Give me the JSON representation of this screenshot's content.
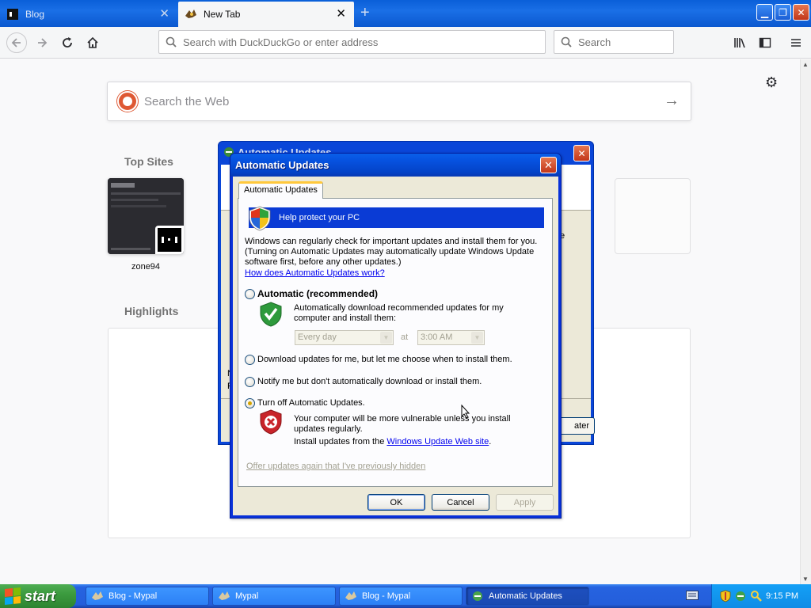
{
  "browser": {
    "tabs": [
      {
        "title": "Blog",
        "active": false
      },
      {
        "title": "New Tab",
        "active": true
      }
    ],
    "urlbar_placeholder": "Search with DuckDuckGo or enter address",
    "searchbar_placeholder": "Search"
  },
  "newtab": {
    "websearch_placeholder": "Search the Web",
    "top_sites_title": "Top Sites",
    "top_sites": [
      {
        "label": "zone94"
      }
    ],
    "highlights_title": "Highlights"
  },
  "background_window": {
    "title": "Automatic Updates",
    "fragment_1": "N",
    "fragment_2": "F",
    "fragment_3": "e",
    "button_fragment": "ater"
  },
  "dialog": {
    "title": "Automatic Updates",
    "tab_label": "Automatic Updates",
    "banner": "Help protect your PC",
    "intro_line1": "Windows can regularly check for important updates and install them for you.",
    "intro_line2": "(Turning on Automatic Updates may automatically update Windows Update",
    "intro_line3": "software first, before any other updates.)",
    "help_link": "How does Automatic Updates work?",
    "options": {
      "automatic_label": "Automatic (recommended)",
      "automatic_desc1": "Automatically download recommended updates for my",
      "automatic_desc2": "computer and install them:",
      "day_value": "Every day",
      "at_label": "at",
      "time_value": "3:00 AM",
      "download_label": "Download updates for me, but let me choose when to install them.",
      "notify_label": "Notify me but don't automatically download or install them.",
      "off_label": "Turn off Automatic Updates.",
      "off_desc1": "Your computer will be more vulnerable unless you install",
      "off_desc2": "updates regularly.",
      "off_desc3_prefix": "Install updates from the ",
      "off_desc3_link": "Windows Update Web site",
      "off_desc3_suffix": "."
    },
    "selected_option": "Turn off Automatic Updates.",
    "offer_link": "Offer updates again that I've previously hidden",
    "ok_label": "OK",
    "cancel_label": "Cancel",
    "apply_label": "Apply"
  },
  "taskbar": {
    "start_label": "start",
    "items": [
      {
        "label": "Blog - Mypal",
        "active": false
      },
      {
        "label": "Mypal",
        "active": false
      },
      {
        "label": "Blog - Mypal",
        "active": false
      },
      {
        "label": "Automatic Updates",
        "active": true
      }
    ],
    "clock": "9:15 PM"
  },
  "colors": {
    "xp_blue": "#0831d9",
    "xp_taskbar": "#245edb",
    "xp_start_green": "#3c9b3f",
    "dialog_face": "#ece9d8",
    "banner_blue": "#0a3bd5",
    "link_blue": "#0000ee"
  },
  "icons": [
    "search-icon",
    "back-arrow-icon",
    "forward-arrow-icon",
    "reload-icon",
    "home-icon",
    "library-icon",
    "sidebar-icon",
    "menu-icon",
    "gear-icon",
    "shield-icon",
    "keyboard-icon",
    "clock"
  ]
}
